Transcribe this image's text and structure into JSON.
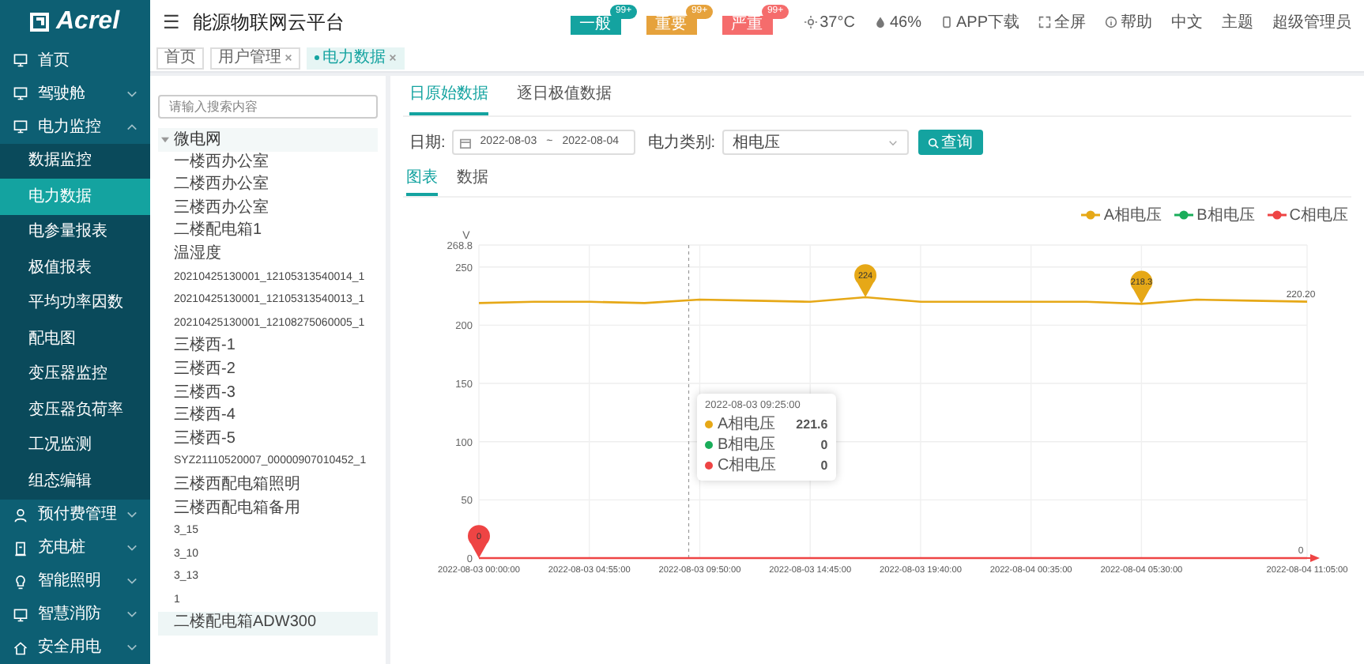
{
  "sidebar": {
    "logo": "Acrel",
    "items": [
      {
        "label": "首页",
        "expanded": false,
        "has_children": false
      },
      {
        "label": "驾驶舱",
        "expanded": false,
        "has_children": true
      },
      {
        "label": "电力监控",
        "expanded": true,
        "has_children": true,
        "children": [
          {
            "label": "数据监控",
            "selected": false
          },
          {
            "label": "电力数据",
            "selected": true
          },
          {
            "label": "电参量报表",
            "selected": false
          },
          {
            "label": "极值报表",
            "selected": false
          },
          {
            "label": "平均功率因数",
            "selected": false
          },
          {
            "label": "配电图",
            "selected": false
          },
          {
            "label": "变压器监控",
            "selected": false
          },
          {
            "label": "变压器负荷率",
            "selected": false
          },
          {
            "label": "工况监测",
            "selected": false
          },
          {
            "label": "组态编辑",
            "selected": false
          }
        ]
      },
      {
        "label": "预付费管理",
        "expanded": false,
        "has_children": true
      },
      {
        "label": "充电桩",
        "expanded": false,
        "has_children": true
      },
      {
        "label": "智能照明",
        "expanded": false,
        "has_children": true
      },
      {
        "label": "智慧消防",
        "expanded": false,
        "has_children": true
      },
      {
        "label": "安全用电",
        "expanded": false,
        "has_children": true
      }
    ]
  },
  "header": {
    "menu_glyph": "☰",
    "title": "能源物联网云平台",
    "alarms": [
      {
        "label": "一般",
        "count": "99+",
        "color": "#14a3a0"
      },
      {
        "label": "重要",
        "count": "99+",
        "color": "#e6a23c"
      },
      {
        "label": "严重",
        "count": "99+",
        "color": "#f56c6c"
      }
    ],
    "status": [
      {
        "kind": "temp",
        "text": "37°C"
      },
      {
        "kind": "humidity",
        "text": "46%"
      },
      {
        "kind": "app",
        "text": "APP下载"
      },
      {
        "kind": "fullscreen",
        "text": "全屏"
      },
      {
        "kind": "help",
        "text": "帮助"
      },
      {
        "kind": "plain",
        "text": "中文"
      },
      {
        "kind": "plain",
        "text": "主题"
      },
      {
        "kind": "plain",
        "text": "超级管理员"
      }
    ]
  },
  "breadcrumb_tabs": [
    {
      "label": "首页",
      "closable": false,
      "selected": false
    },
    {
      "label": "用户管理",
      "closable": true,
      "selected": false
    },
    {
      "label": "电力数据",
      "closable": true,
      "selected": true
    }
  ],
  "tree": {
    "search_placeholder": "请输入搜索内容",
    "root": {
      "label": "微电网",
      "expanded": true,
      "children": [
        {
          "label": "一楼西办公室",
          "selected": false
        },
        {
          "label": "二楼西办公室",
          "selected": false
        },
        {
          "label": "三楼西办公室",
          "selected": false
        },
        {
          "label": "二楼配电箱1",
          "selected": false
        },
        {
          "label": "温湿度",
          "selected": false
        },
        {
          "label": "20210425130001_12105313540014_1",
          "selected": false
        },
        {
          "label": "20210425130001_12105313540013_1",
          "selected": false
        },
        {
          "label": "20210425130001_12108275060005_1",
          "selected": false
        },
        {
          "label": "三楼西-1",
          "selected": false
        },
        {
          "label": "三楼西-2",
          "selected": false
        },
        {
          "label": "三楼西-3",
          "selected": false
        },
        {
          "label": "三楼西-4",
          "selected": false
        },
        {
          "label": "三楼西-5",
          "selected": false
        },
        {
          "label": "SYZ21110520007_00000907010452_1",
          "selected": false
        },
        {
          "label": "三楼西配电箱照明",
          "selected": false
        },
        {
          "label": "三楼西配电箱备用",
          "selected": false
        },
        {
          "label": "3_15",
          "selected": false
        },
        {
          "label": "3_10",
          "selected": false
        },
        {
          "label": "3_13",
          "selected": false
        },
        {
          "label": "1",
          "selected": false
        },
        {
          "label": "二楼配电箱ADW300",
          "selected": true
        }
      ]
    }
  },
  "main": {
    "tabs": [
      {
        "label": "日原始数据",
        "selected": true
      },
      {
        "label": "逐日极值数据",
        "selected": false
      }
    ],
    "filter": {
      "date_label": "日期:",
      "date_start": "2022-08-03",
      "date_sep": "~",
      "date_end": "2022-08-04",
      "type_label": "电力类别:",
      "type_value": "相电压",
      "query_button": "查询"
    },
    "view_tabs": [
      {
        "label": "图表",
        "selected": true
      },
      {
        "label": "数据",
        "selected": false
      }
    ],
    "chart_data": {
      "type": "line",
      "ylabel": "V",
      "categories": [
        "2022-08-03 00:00:00",
        null,
        "2022-08-03 04:55:00",
        null,
        "2022-08-03 09:50:00",
        null,
        "2022-08-03 14:45:00",
        null,
        "2022-08-03 19:40:00",
        null,
        "2022-08-04 00:35:00",
        null,
        "2022-08-04 05:30:00",
        null,
        null,
        "2022-08-04 11:05:00"
      ],
      "ylim": [
        0,
        268.8
      ],
      "grid": true,
      "legend": true,
      "yticks": [
        0,
        50,
        100,
        150,
        200,
        250,
        268.8
      ],
      "series": [
        {
          "name": "A相电压",
          "color": "#e6a817",
          "values": [
            219,
            220,
            220,
            219,
            222,
            221,
            220,
            224,
            220,
            220,
            220,
            220,
            218.3,
            222,
            221,
            220.2
          ]
        },
        {
          "name": "B相电压",
          "color": "#1aad5a",
          "values": [
            null,
            null,
            null,
            null,
            null,
            null,
            null,
            null,
            null,
            null,
            null,
            null,
            null,
            null,
            null,
            null
          ]
        },
        {
          "name": "C相电压",
          "color": "#ee4444",
          "values": [
            0,
            0,
            0,
            0,
            0,
            0,
            0,
            0,
            0,
            0,
            0,
            0,
            0,
            0,
            0,
            0
          ]
        }
      ],
      "annotations": [
        {
          "y": 224,
          "text": "224"
        },
        {
          "y": 218.3,
          "text": "218.3"
        },
        {
          "x": "2022-08-03 00:00:00",
          "y": 0,
          "text": "0"
        },
        {
          "x": "2022-08-04 11:05:00",
          "y": 220.2,
          "text": "220.20"
        },
        {
          "x": "2022-08-04 11:05:00",
          "y": 0,
          "text": "0"
        }
      ]
    },
    "tooltip": {
      "title": "2022-08-03 09:25:00",
      "rows": [
        {
          "name": "A相电压",
          "value": "221.6",
          "color": "#e6a817"
        },
        {
          "name": "B相电压",
          "value": "0",
          "color": "#1aad5a"
        },
        {
          "name": "C相电压",
          "value": "0",
          "color": "#ee4444"
        }
      ]
    }
  }
}
